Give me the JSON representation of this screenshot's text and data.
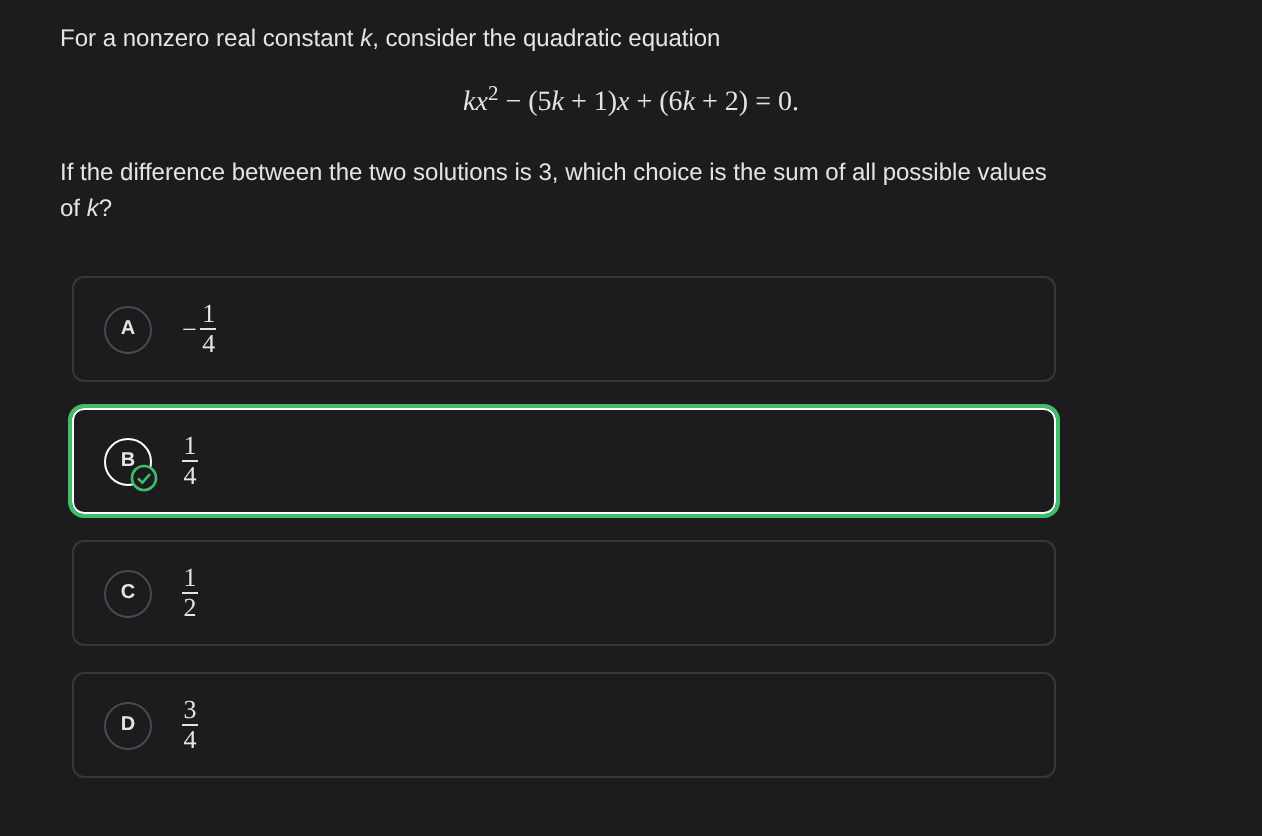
{
  "intro": "For a nonzero real constant *k*, consider the quadratic equation",
  "equation": [
    "*kx*$^{2}$ − (5",
    "*k* + 1)*x* + (6",
    "*k* + 2) = 0."
  ],
  "question": "If the difference between the two solutions is 3, which choice is the sum of all possible values of *k*?",
  "choices": [
    {
      "letter": "A",
      "sign": "−",
      "numerator": "1",
      "denominator": "4",
      "selected": false
    },
    {
      "letter": "B",
      "numerator": "1",
      "denominator": "4",
      "selected": true
    },
    {
      "letter": "C",
      "numerator": "1",
      "denominator": "2",
      "selected": false
    },
    {
      "letter": "D",
      "numerator": "3",
      "denominator": "4",
      "selected": false
    }
  ]
}
